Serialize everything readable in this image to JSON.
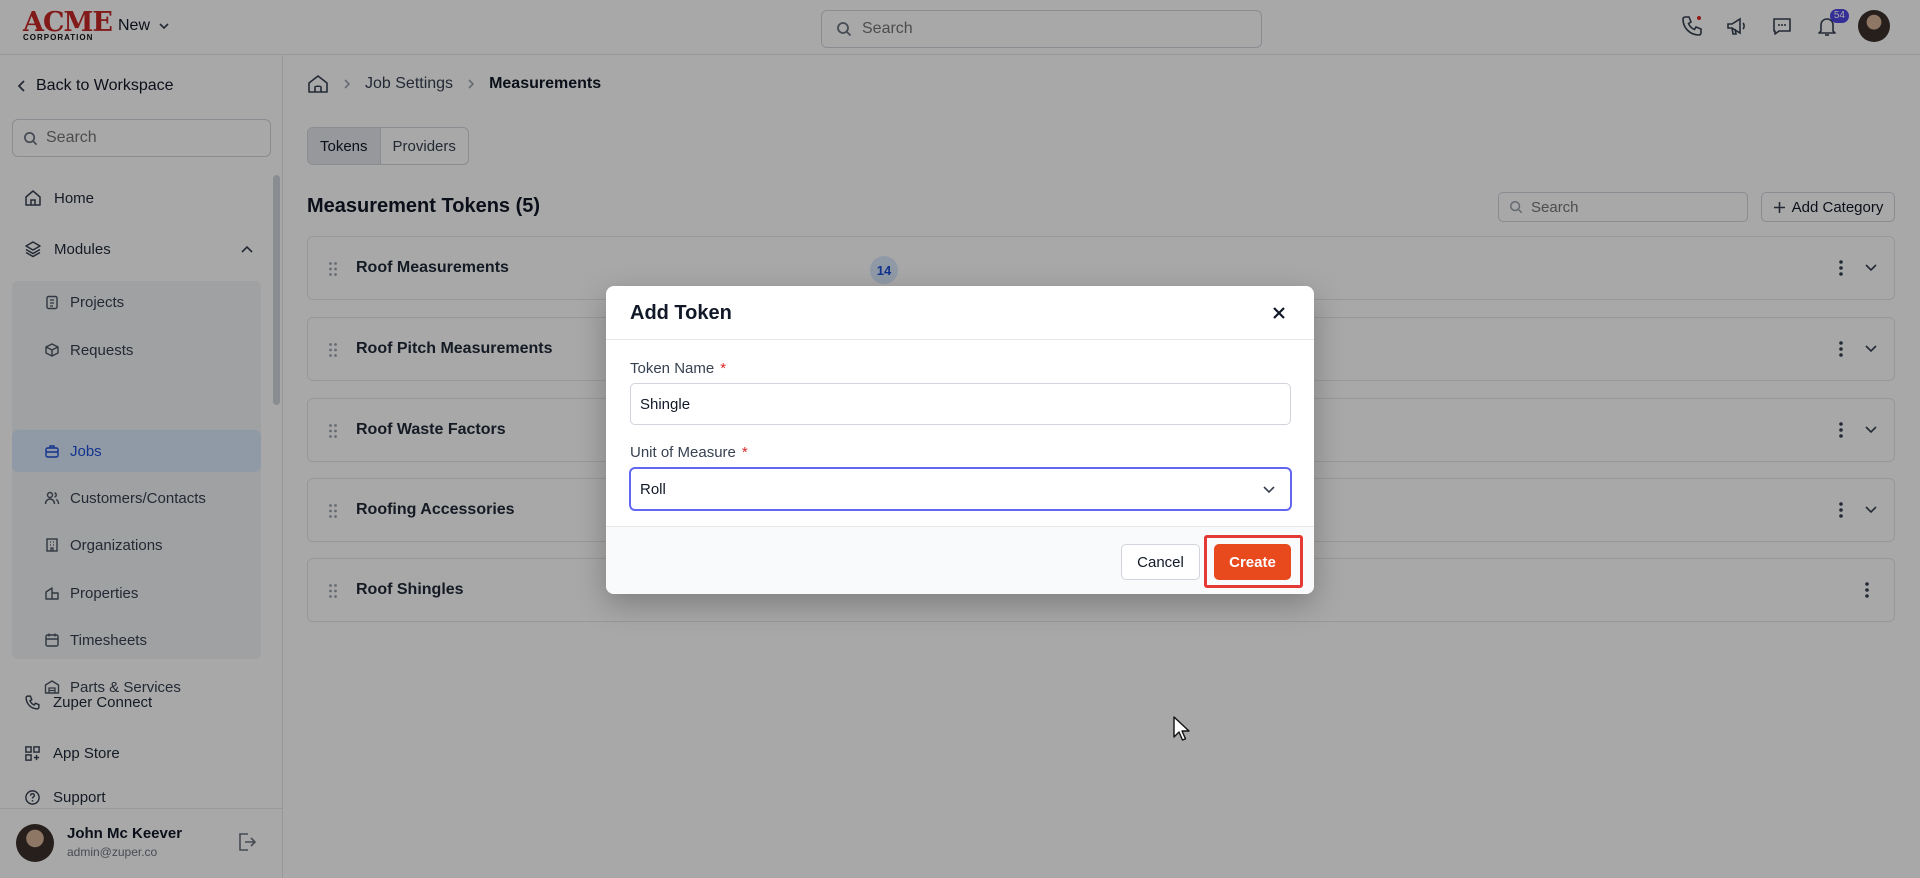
{
  "topbar": {
    "logo_line1": "ACME",
    "logo_line2": "CORPORATION",
    "new_label": "New",
    "search_placeholder": "Search",
    "notification_count": "54"
  },
  "sidebar": {
    "back_label": "Back to Workspace",
    "search_placeholder": "Search",
    "home_label": "Home",
    "modules_label": "Modules",
    "module_items": [
      {
        "label": "Projects",
        "icon": "clipboard-icon"
      },
      {
        "label": "Requests",
        "icon": "box-icon"
      },
      {
        "label": "Jobs",
        "icon": "briefcase-icon",
        "active": true
      },
      {
        "label": "Customers/Contacts",
        "icon": "users-icon"
      },
      {
        "label": "Organizations",
        "icon": "building-icon"
      },
      {
        "label": "Properties",
        "icon": "property-icon"
      },
      {
        "label": "Timesheets",
        "icon": "calendar-icon"
      },
      {
        "label": "Parts & Services",
        "icon": "warehouse-icon"
      }
    ],
    "zuper_connect_label": "Zuper Connect",
    "app_store_label": "App Store",
    "support_label": "Support",
    "user": {
      "name": "John Mc Keever",
      "email": "admin@zuper.co"
    }
  },
  "main": {
    "breadcrumb": {
      "parent": "Job Settings",
      "current": "Measurements"
    },
    "tabs": [
      {
        "label": "Tokens",
        "active": true
      },
      {
        "label": "Providers",
        "active": false
      }
    ],
    "section_title": "Measurement Tokens (5)",
    "search_placeholder": "Search",
    "add_category_label": "Add Category",
    "categories": [
      {
        "name": "Roof Measurements",
        "count": "14"
      },
      {
        "name": "Roof Pitch Measurements"
      },
      {
        "name": "Roof Waste Factors"
      },
      {
        "name": "Roofing Accessories"
      },
      {
        "name": "Roof Shingles"
      }
    ]
  },
  "modal": {
    "title": "Add Token",
    "token_name_label": "Token Name",
    "token_name_value": "Shingle",
    "unit_label": "Unit of Measure",
    "unit_value": "Roll",
    "required_mark": "*",
    "cancel_label": "Cancel",
    "create_label": "Create"
  },
  "colors": {
    "accent": "#e8491d",
    "active_nav": "#dbeafe",
    "highlight": "#e53935",
    "badge": "#4f46e5"
  }
}
